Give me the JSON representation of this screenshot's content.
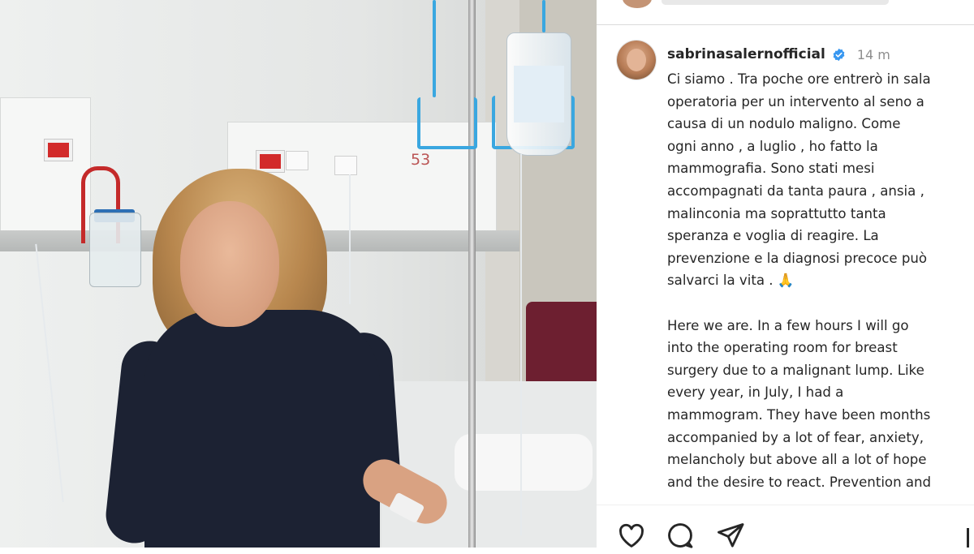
{
  "post": {
    "image_description": "",
    "room_number": "53"
  },
  "panel": {
    "username": "sabrinasalernofficial",
    "time": "14 m",
    "caption_it": "Ci siamo . Tra poche ore entrerò in sala\noperatoria per un intervento al seno a\ncausa di un nodulo maligno. Come\nogni anno , a luglio , ho fatto la\nmammografia. Sono stati mesi\naccompagnati da tanta paura , ansia ,\nmalinconia ma soprattutto tanta\nsperanza e voglia di reagire. La\nprevenzione e la diagnosi precoce può\nsalvarci la vita . 🙏",
    "caption_en": "Here we are. In a few hours I will go\ninto the operating room for breast\nsurgery due to a malignant lump. Like\nevery year, in July, I had a\nmammogram. They have been months\naccompanied by a lot of fear, anxiety,\nmelancholy but above all a lot of hope\nand the desire to react. Prevention and\nearly diagnoses can save our lives"
  },
  "icons": {
    "verified": "verified-badge-icon",
    "like": "heart-icon",
    "comment": "comment-bubble-icon",
    "share": "paper-plane-icon",
    "save": "bookmark-icon"
  },
  "colors": {
    "verified_blue": "#3897f0",
    "text": "#262626",
    "muted": "#8e8e8e"
  }
}
